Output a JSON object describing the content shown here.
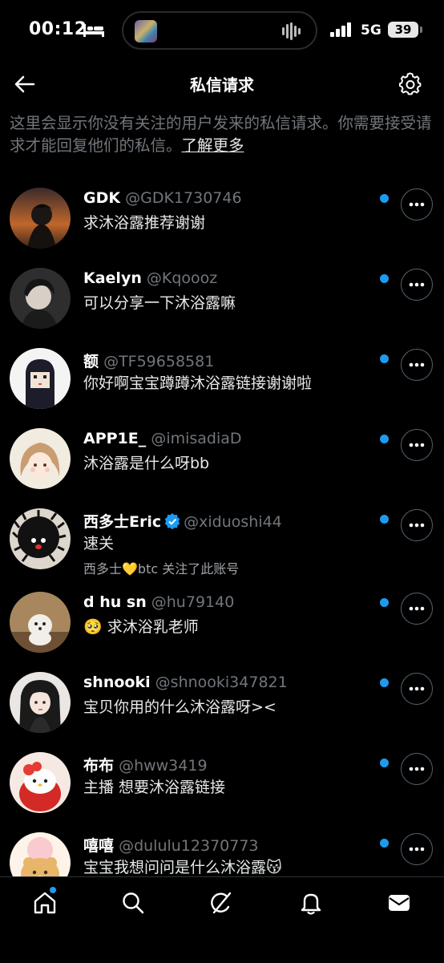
{
  "status_bar": {
    "time": "00:12",
    "network": "5G",
    "battery": "39"
  },
  "header": {
    "title": "私信请求"
  },
  "intro": {
    "text": "这里会显示你没有关注的用户发来的私信请求。你需要接受请求才能回复他们的私信。",
    "link": "了解更多"
  },
  "requests": [
    {
      "name": "GDK",
      "handle": "@GDK1730746",
      "message": "求沐浴露推荐谢谢",
      "unread": true
    },
    {
      "name": "Kaelyn",
      "handle": "@Kqoooz",
      "message": "可以分享一下沐浴露嘛",
      "unread": true
    },
    {
      "name": "额",
      "handle": "@TF59658581",
      "message": "你好啊宝宝蹲蹲沐浴露链接谢谢啦",
      "unread": true
    },
    {
      "name": "APP1E_",
      "handle": "@imisadiaD",
      "message": "沐浴露是什么呀bb",
      "unread": true
    },
    {
      "name": "西多士Eric",
      "handle": "@xiduoshi44",
      "message": "速关",
      "note": "西多士💛btc 关注了此账号",
      "verified": true,
      "unread": true
    },
    {
      "name": "d hu sn",
      "handle": "@hu79140",
      "message": "🥺 求沐浴乳老师",
      "unread": true
    },
    {
      "name": "shnooki",
      "handle": "@shnooki347821",
      "message": "宝贝你用的什么沐浴露呀><",
      "unread": true
    },
    {
      "name": "布布",
      "handle": "@hww3419",
      "message": "主播 想要沐浴露链接",
      "unread": true
    },
    {
      "name": "嘻嘻",
      "handle": "@dululu12370773",
      "message": "宝宝我想问问是什么沐浴露😽",
      "unread": true
    }
  ],
  "bottom_nav": [
    "home-icon",
    "search-icon",
    "grok-icon",
    "bell-icon",
    "mail-icon"
  ],
  "colors": {
    "accent": "#1d9bf0",
    "background": "#000000",
    "secondary_text": "#71767b"
  }
}
